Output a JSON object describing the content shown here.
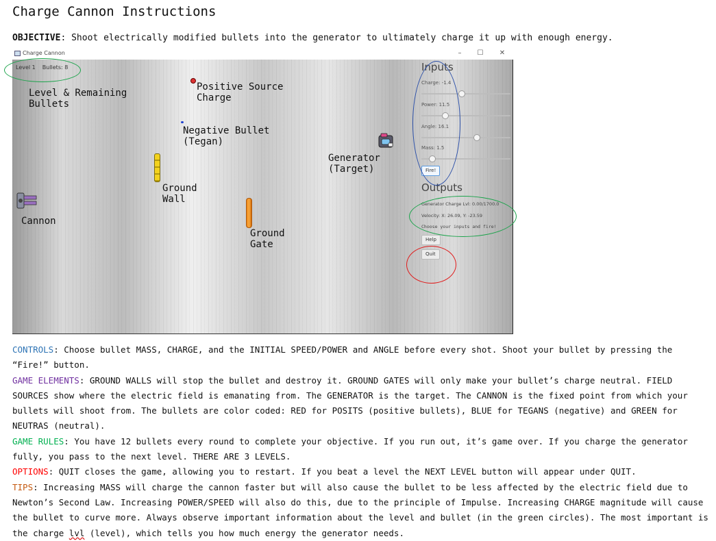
{
  "doc": {
    "title": "Charge Cannon Instructions",
    "objective_label": "OBJECTIVE",
    "objective_text": ": Shoot electrically modified bullets into the generator to ultimately charge it up with enough energy."
  },
  "window": {
    "title": "Charge Cannon",
    "controls": {
      "minimize": "–",
      "maximize": "☐",
      "close": "✕"
    }
  },
  "game": {
    "level": "Level 1",
    "bullets": "Bullets: 8",
    "annotations": {
      "level_bullets": [
        "Level & Remaining",
        "Bullets"
      ],
      "positive_source": [
        "Positive Source",
        "Charge"
      ],
      "negative_bullet": [
        "Negative Bullet",
        "(Tegan)"
      ],
      "generator": [
        "Generator",
        "(Target)"
      ],
      "ground_wall": [
        "Ground",
        "Wall"
      ],
      "cannon": "Cannon",
      "ground_gate": [
        "Ground",
        "Gate"
      ]
    }
  },
  "inputs": {
    "heading": "Inputs",
    "sliders": [
      {
        "label": "Charge: -1.4",
        "level": 0.45
      },
      {
        "label": "Power: 11.5",
        "level": 0.27
      },
      {
        "label": "Angle: 16.1",
        "level": 0.62
      },
      {
        "label": "Mass: 1.5",
        "level": 0.12
      }
    ],
    "fire_label": "Fire!"
  },
  "outputs": {
    "heading": "Outputs",
    "generator_charge": "Generator Charge Lvl: 0.00/1700.0",
    "velocity": "Velocity: X: 26.09, Y: -23.59",
    "prompt": "Choose your inputs and fire!",
    "help_label": "Help",
    "quit_label": "Quit"
  },
  "colors": {
    "controls": "#2e74b5",
    "game_elements": "#7030a0",
    "game_rules": "#00b050",
    "options": "#ff0000",
    "tips": "#c55a11",
    "ring_green": "#1aa34a",
    "ring_blue": "#2b4fa8",
    "ring_red": "#e01b1b"
  },
  "sections": {
    "controls": {
      "label": "CONTROLS",
      "text": ": Choose bullet MASS, CHARGE, and the INITIAL SPEED/POWER and ANGLE before every shot. Shoot your bullet by pressing the “Fire!” button."
    },
    "game_elements": {
      "label": "GAME ELEMENTS",
      "text": ": GROUND WALLS will stop the bullet and destroy it. GROUND GATES will only make your bullet’s charge neutral. FIELD SOURCES show where the electric field is emanating from. The GENERATOR is the target. The CANNON is the fixed point from which your bullets will shoot from. The bullets are color coded: RED for POSITS (positive bullets), BLUE for TEGANS (negative) and GREEN for NEUTRAS (neutral)."
    },
    "game_rules": {
      "label": "GAME RULES",
      "text": ": You have 12 bullets every round to complete your objective. If you run out, it’s game over. If you charge the generator fully, you pass to the next level. THERE ARE 3 LEVELS."
    },
    "options": {
      "label": "OPTIONS",
      "text": ": QUIT closes the game, allowing you to restart. If you beat a level the NEXT LEVEL button will appear under QUIT."
    },
    "tips": {
      "label": "TIPS",
      "text_a": ": Increasing MASS will charge the cannon faster but will also cause the bullet to be less affected by the electric field due to Newton’s Second Law. Increasing POWER/SPEED will also do this, due to the principle of Impulse. Increasing CHARGE magnitude will cause the bullet to curve more. Always observe important information about the level and bullet (in the green circles). The most important is the charge ",
      "lvl_word": "lvl",
      "text_b": " (level), which tells you how much energy the generator needs."
    }
  }
}
